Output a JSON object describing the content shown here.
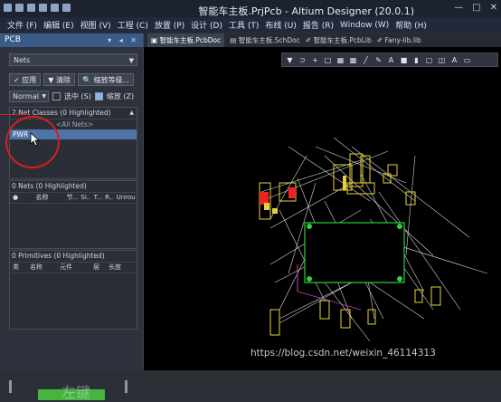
{
  "window": {
    "title": "智能车主板.PrjPcb - Altium Designer (20.0.1)",
    "controls": [
      "—",
      "□",
      "✕"
    ]
  },
  "menu": [
    "文件 (F)",
    "编辑 (E)",
    "视图 (V)",
    "工程 (C)",
    "放置 (P)",
    "设计 (D)",
    "工具 (T)",
    "布线 (U)",
    "报告 (R)",
    "Window (W)",
    "帮助 (H)"
  ],
  "panel": {
    "title": "PCB",
    "controls": "▾ ◂ ✕",
    "mode_dropdown": "Nets",
    "buttons": {
      "apply": "应用",
      "clear": "清除",
      "zoom_level": "缩放等级..."
    },
    "options": {
      "normal": "Normal",
      "select": "选中 (S)",
      "zoom": "缩放 (Z)"
    },
    "net_classes": {
      "header": "2 Net Classes (0 Highlighted)",
      "items": [
        "<All Nets>",
        "PWR"
      ]
    },
    "nets": {
      "header": "0 Nets (0 Highlighted)",
      "columns": [
        "名称",
        "节...",
        "Si...",
        "T...",
        "R...",
        "Unrou"
      ]
    },
    "primitives": {
      "header": "0 Primitives (0 Highlighted)",
      "columns": [
        "类",
        "名称",
        "元件",
        "层",
        "长度"
      ]
    },
    "footer_text": "左键"
  },
  "tabs": [
    "智能车主板.PcbDoc",
    "智能车主板.SchDoc",
    "智能车主板.PcbLib",
    "Fany-lib.lib"
  ],
  "toolbar_icons": [
    "filter-icon",
    "route-icon",
    "plus-icon",
    "rect-icon",
    "bar-icon",
    "grid-icon",
    "line-icon",
    "pen-icon",
    "a-icon",
    "box-icon",
    "chart-icon",
    "square-icon",
    "frame-icon",
    "text-icon",
    "ruler-icon"
  ],
  "toolbar_glyphs": [
    "▼",
    "⊃",
    "+",
    "□",
    "▦",
    "▩",
    "╱",
    "✎",
    "A",
    "■",
    "▮",
    "▢",
    "◫",
    "A",
    "▭"
  ],
  "watermark": "https://blog.csdn.net/weixin_46114313"
}
